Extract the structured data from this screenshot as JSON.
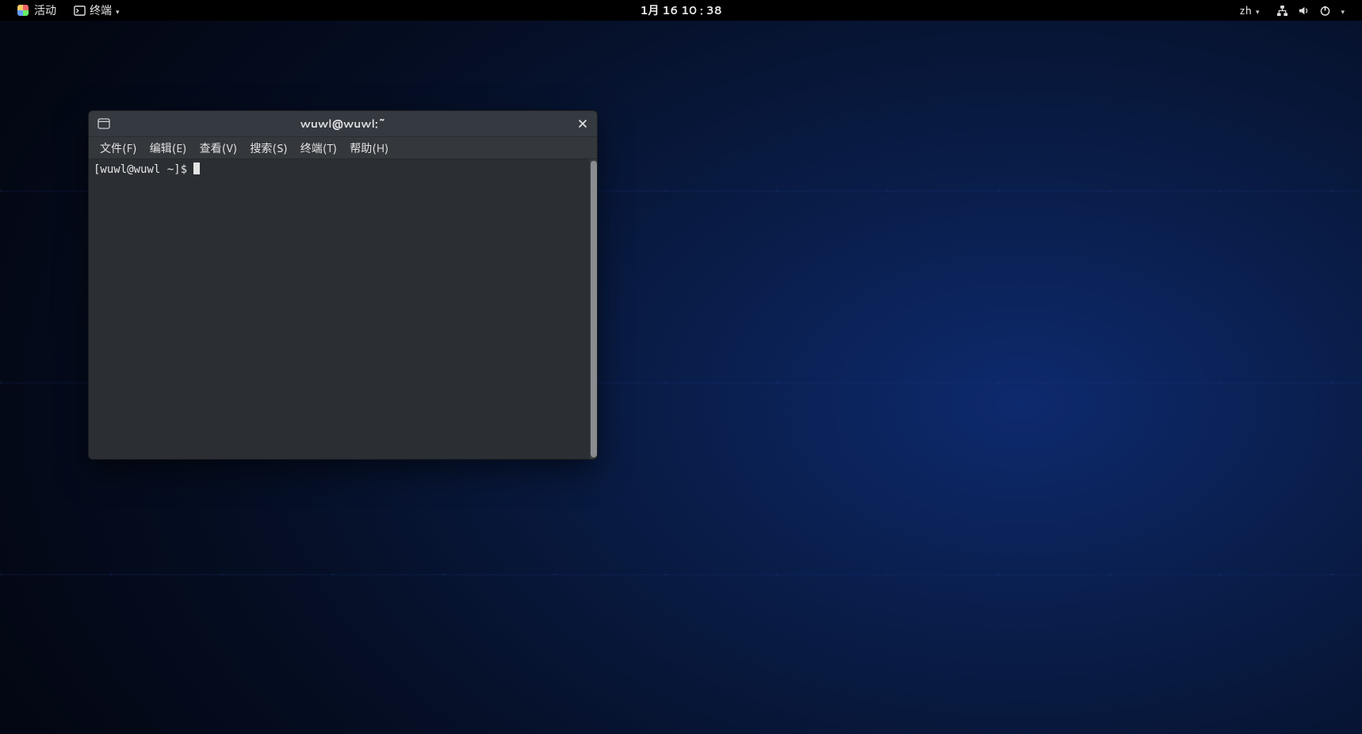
{
  "topbar": {
    "activities_label": "活动",
    "app_menu_label": "终端",
    "clock": "1月 16 10 : 38",
    "input_method": "zh"
  },
  "window": {
    "title": "wuwl@wuwl:~",
    "menus": {
      "file": "文件(F)",
      "edit": "编辑(E)",
      "view": "查看(V)",
      "search": "搜索(S)",
      "terminal": "终端(T)",
      "help": "帮助(H)"
    },
    "terminal": {
      "prompt": "[wuwl@wuwl ~]$ "
    }
  }
}
